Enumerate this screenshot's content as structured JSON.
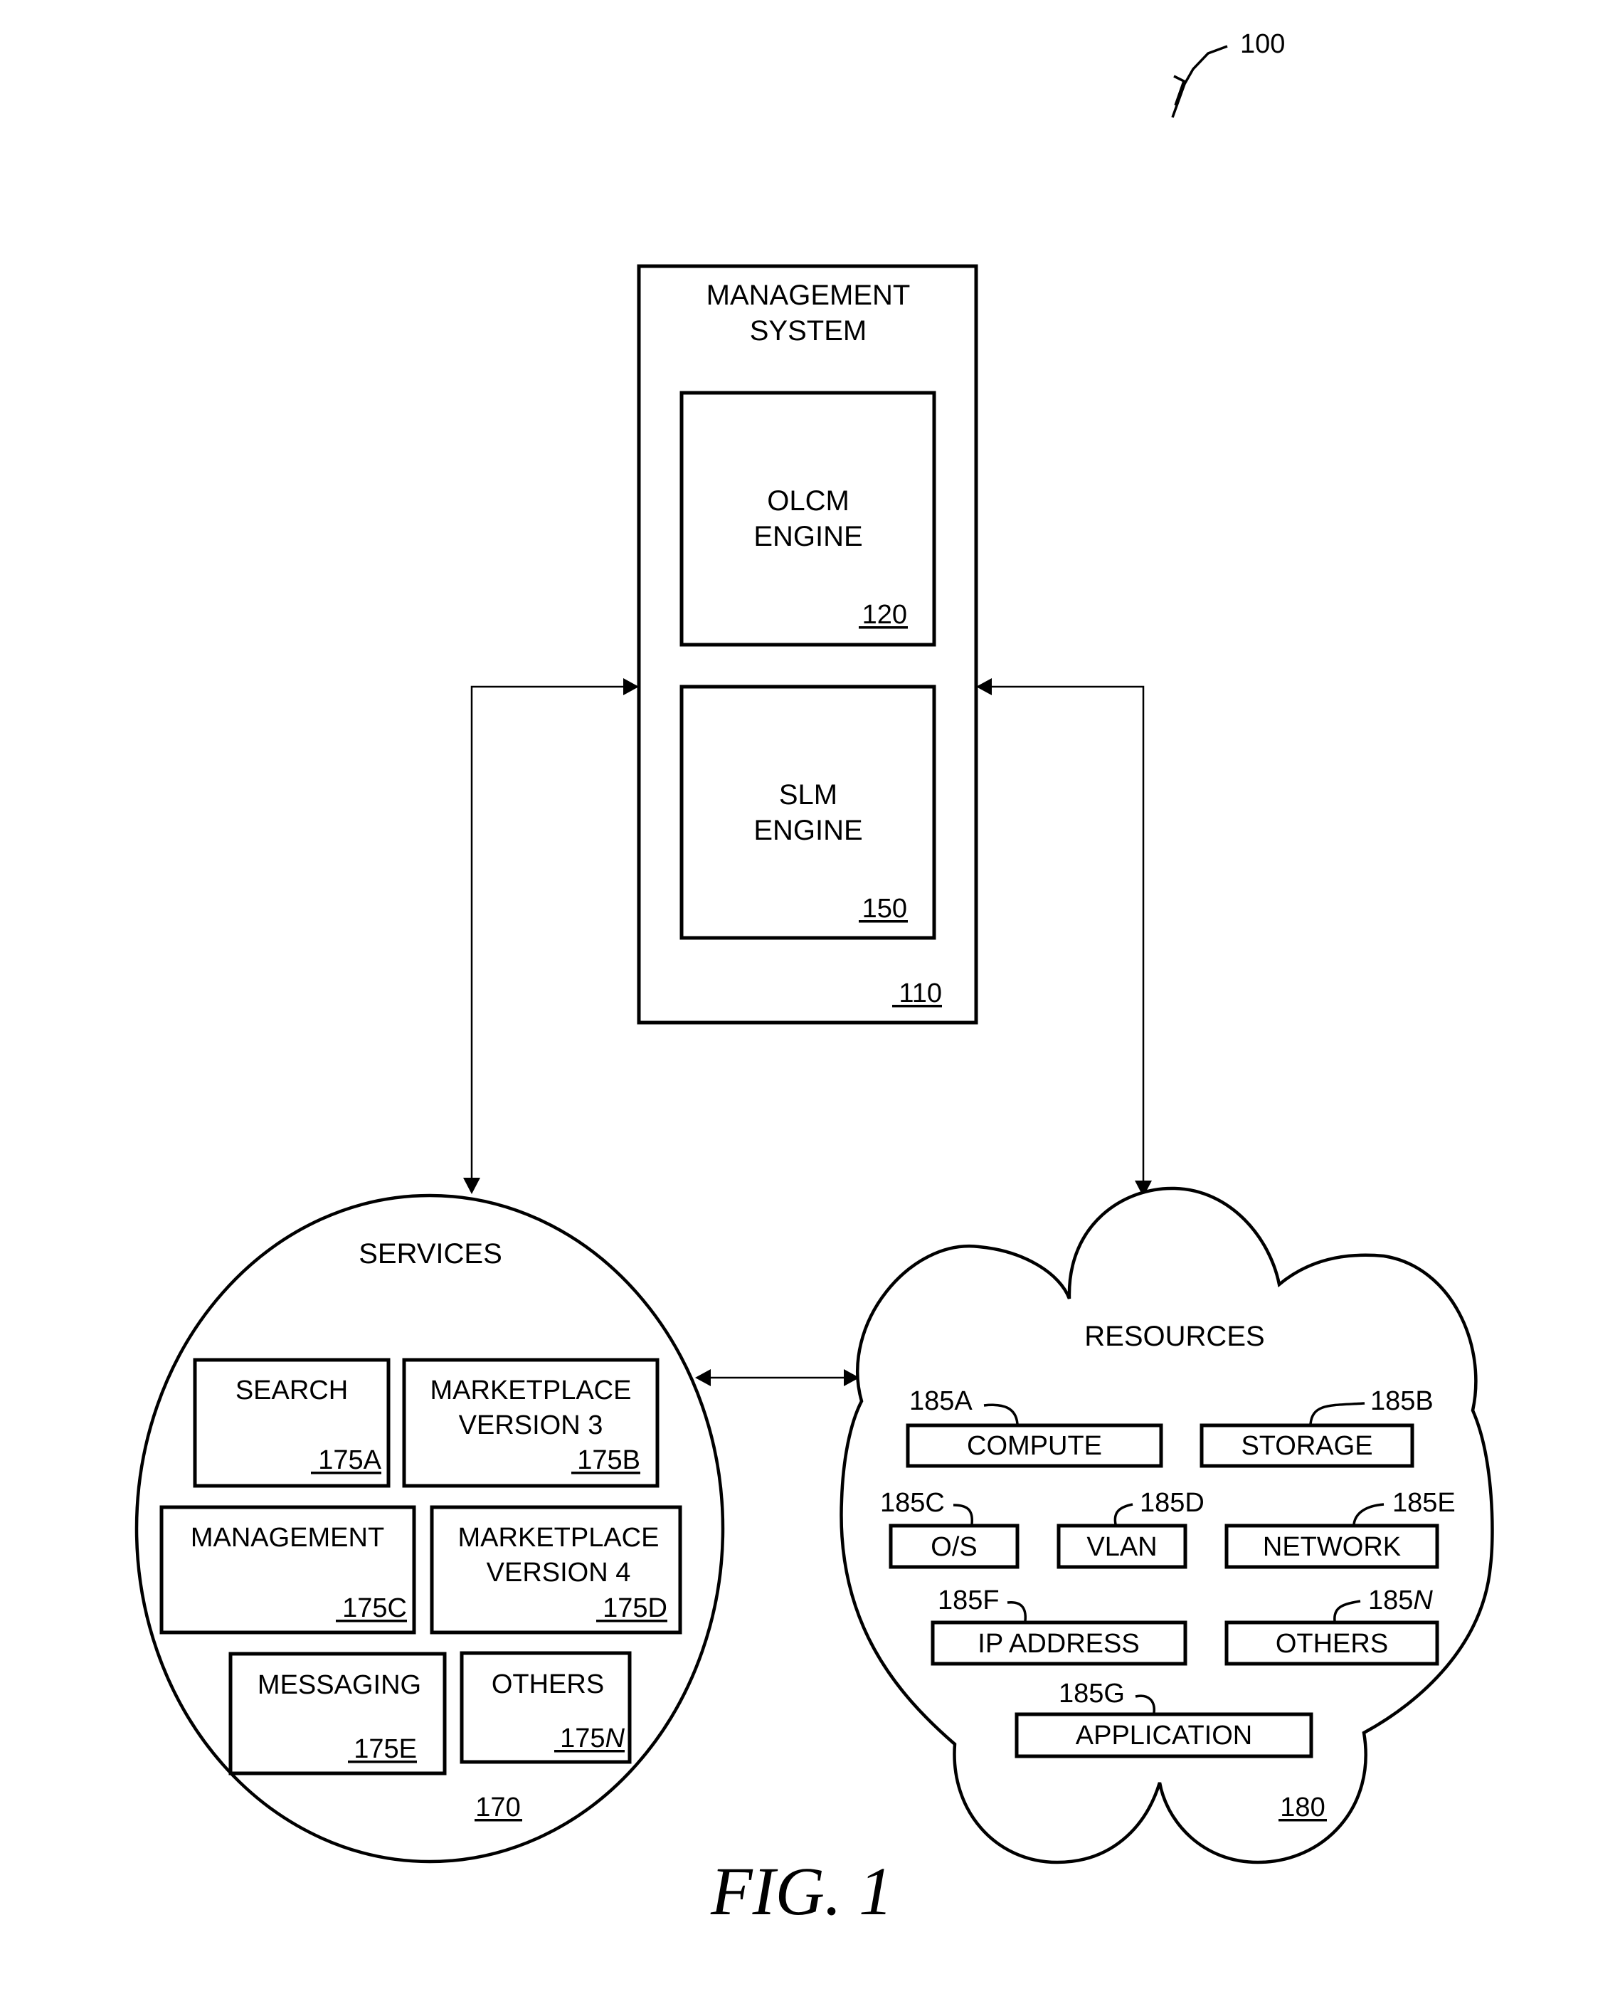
{
  "figure": {
    "ref": "100",
    "caption": "FIG. 1"
  },
  "management_system": {
    "title_line1": "MANAGEMENT",
    "title_line2": "SYSTEM",
    "ref": "110",
    "olcm_engine": {
      "line1": "OLCM",
      "line2": "ENGINE",
      "ref": "120"
    },
    "slm_engine": {
      "line1": "SLM",
      "line2": "ENGINE",
      "ref": "150"
    }
  },
  "services": {
    "title": "SERVICES",
    "ref": "170",
    "items": [
      {
        "line1": "SEARCH",
        "line2": "",
        "ref": "175A"
      },
      {
        "line1": "MARKETPLACE",
        "line2": "VERSION 3",
        "ref": "175B"
      },
      {
        "line1": "MANAGEMENT",
        "line2": "",
        "ref": "175C"
      },
      {
        "line1": "MARKETPLACE",
        "line2": "VERSION 4",
        "ref": "175D"
      },
      {
        "line1": "MESSAGING",
        "line2": "",
        "ref": "175E"
      },
      {
        "line1": "OTHERS",
        "line2": "",
        "ref": "175",
        "ref_suffix": "N"
      }
    ]
  },
  "resources": {
    "title": "RESOURCES",
    "ref": "180",
    "items": [
      {
        "label": "COMPUTE",
        "ref": "185A"
      },
      {
        "label": "STORAGE",
        "ref": "185B"
      },
      {
        "label": "O/S",
        "ref": "185C"
      },
      {
        "label": "VLAN",
        "ref": "185D"
      },
      {
        "label": "NETWORK",
        "ref": "185E"
      },
      {
        "label": "IP ADDRESS",
        "ref": "185F"
      },
      {
        "label": "OTHERS",
        "ref": "185",
        "ref_suffix": "N"
      },
      {
        "label": "APPLICATION",
        "ref": "185G"
      }
    ]
  },
  "connections": [
    {
      "from": "management_system",
      "to": "services",
      "type": "bidirectional"
    },
    {
      "from": "management_system",
      "to": "resources",
      "type": "bidirectional"
    },
    {
      "from": "services",
      "to": "resources",
      "type": "bidirectional"
    }
  ]
}
